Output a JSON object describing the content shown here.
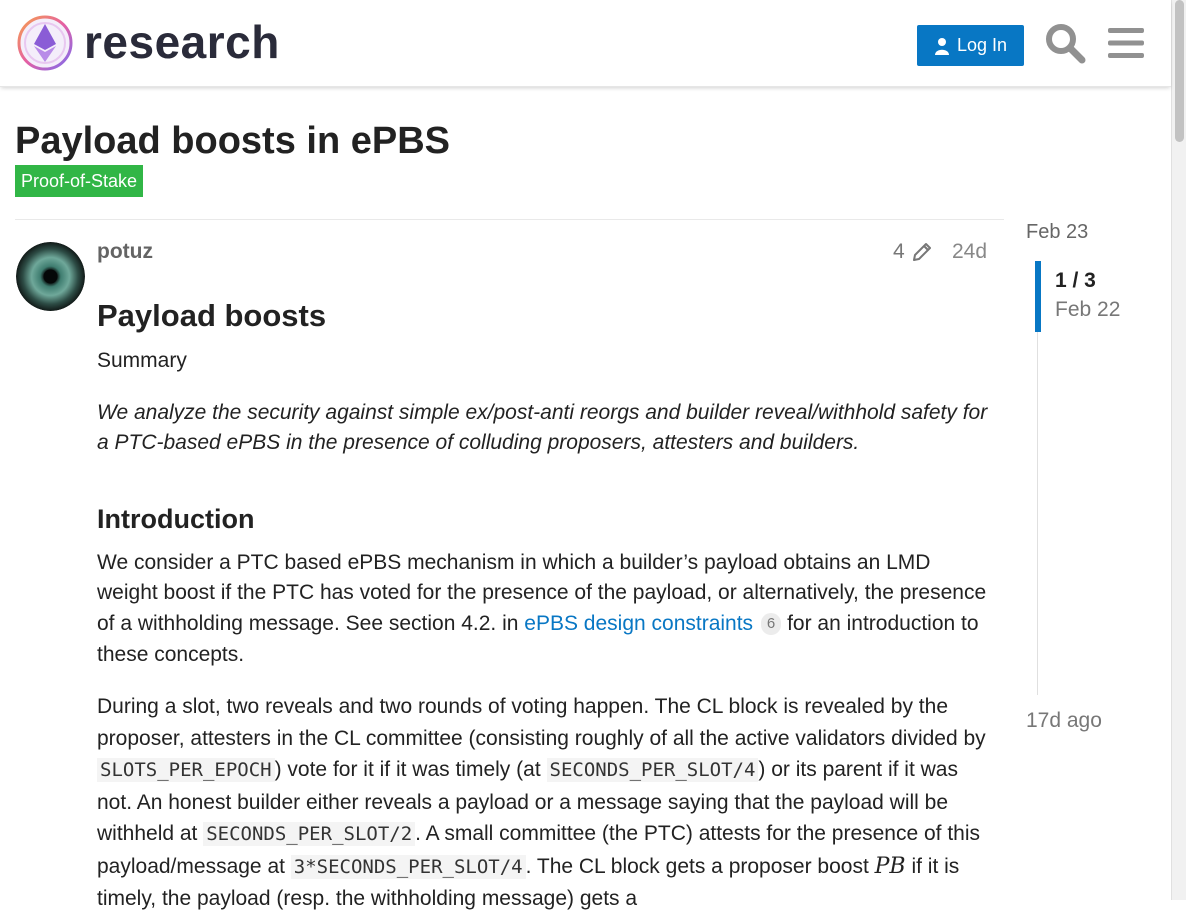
{
  "header": {
    "brand": "research",
    "login_label": "Log In",
    "icons": [
      "ethereum-logo",
      "user-icon",
      "search-icon",
      "hamburger-menu-icon"
    ],
    "accent_color": "#0877c4"
  },
  "topic": {
    "title": "Payload boosts in ePBS",
    "category": "Proof-of-Stake",
    "category_color": "#31b646"
  },
  "post": {
    "username": "potuz",
    "edit_count": "4",
    "date": "24d",
    "heading": "Payload boosts",
    "summary_label": "Summary",
    "abstract": "We analyze the security against simple ex/post-anti reorgs and builder reveal/withhold safety for a PTC-based ePBS in the presence of colluding proposers, attesters and builders.",
    "intro_heading": "Introduction",
    "intro": {
      "before_link": "We consider a PTC based ePBS mechanism in which a builder’s payload obtains an LMD weight boost if the PTC has voted for the presence of the payload, or alternatively, the presence of a withholding message. See section 4.2. in ",
      "link_text": "ePBS design constraints",
      "link_count": "6",
      "after_link": " for an introduction to these concepts."
    },
    "slot": {
      "t1": "During a slot, two reveals and two rounds of voting happen. The CL block is revealed by the proposer, attesters in the CL committee (consisting roughly of all the active validators divided by ",
      "c1": "SLOTS_PER_EPOCH",
      "t2": ") vote for it if it was timely (at ",
      "c2": "SECONDS_PER_SLOT/4",
      "t3": ") or its parent if it was not. An honest builder either reveals a payload or a message saying that the payload will be withheld at ",
      "c3": "SECONDS_PER_SLOT/2",
      "t4": ". A small committee (the PTC) attests for the presence of this payload/message at ",
      "c4": "3*SECONDS_PER_SLOT/4",
      "t5": ". The CL block gets a proposer boost ",
      "math": "PB",
      "t6": " if it is timely, the payload (resp. the withholding message) gets a"
    }
  },
  "timeline": {
    "start": "Feb 23",
    "position": "1 / 3",
    "position_date": "Feb 22",
    "end": "17d ago"
  }
}
